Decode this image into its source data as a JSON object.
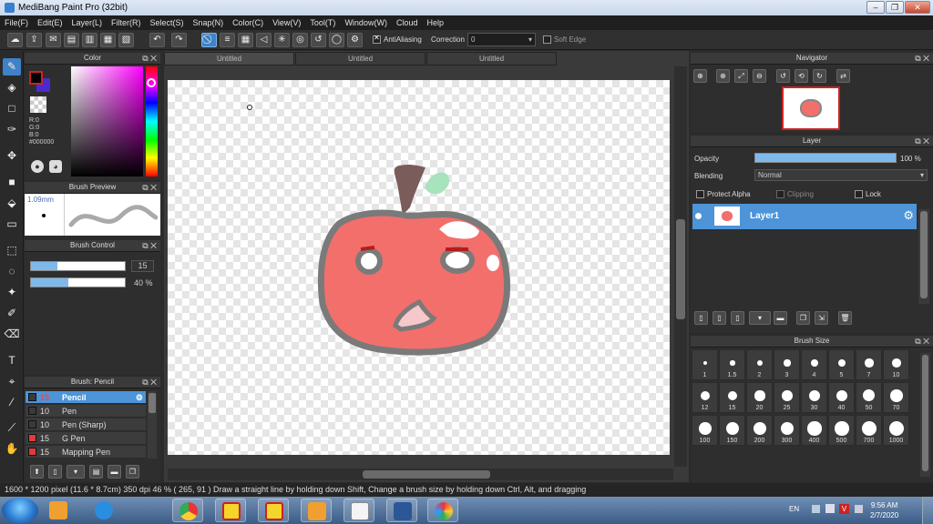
{
  "window": {
    "title": "MediBang Paint Pro (32bit)"
  },
  "menu": [
    "File(F)",
    "Edit(E)",
    "Layer(L)",
    "Filter(R)",
    "Select(S)",
    "Snap(N)",
    "Color(C)",
    "View(V)",
    "Tool(T)",
    "Window(W)",
    "Cloud",
    "Help"
  ],
  "toolbar": {
    "antialiasing_label": "AntiAliasing",
    "correction_label": "Correction",
    "correction_value": "0",
    "soft_edge_label": "Soft Edge"
  },
  "color_panel": {
    "title": "Color",
    "r": "R:0",
    "g": "G:0",
    "b": "B:0",
    "hex": "#000000",
    "foreground": "#000000",
    "background": "#4b2bd0"
  },
  "brush_preview": {
    "title": "Brush Preview",
    "size": "1.09mm"
  },
  "brush_control": {
    "title": "Brush Control",
    "size_value": "15",
    "size_fraction": 0.28,
    "opacity_value": "40 %",
    "opacity_fraction": 0.4
  },
  "brush_list": {
    "title": "Brush: Pencil",
    "items": [
      {
        "size": "15",
        "name": "Pencil",
        "color": "#4d94d8"
      },
      {
        "size": "10",
        "name": "Pen",
        "color": "#3c3c3c"
      },
      {
        "size": "10",
        "name": "Pen (Sharp)",
        "color": "#3c3c3c"
      },
      {
        "size": "15",
        "name": "G Pen",
        "color": "#e23a3a"
      },
      {
        "size": "15",
        "name": "Mapping Pen",
        "color": "#e23a3a"
      }
    ]
  },
  "documents": {
    "tabs": [
      "Untitled",
      "Untitled",
      "Untitled"
    ]
  },
  "navigator": {
    "title": "Navigator"
  },
  "layer_panel": {
    "title": "Layer",
    "opacity_label": "Opacity",
    "opacity_value": "100 %",
    "opacity_fraction": 1.0,
    "blending_label": "Blending",
    "blending_value": "Normal",
    "protect_alpha": "Protect Alpha",
    "clipping": "Clipping",
    "lock": "Lock",
    "layer_name": "Layer1"
  },
  "brush_size": {
    "title": "Brush Size",
    "sizes": [
      "1",
      "1.5",
      "2",
      "3",
      "4",
      "5",
      "7",
      "10",
      "12",
      "15",
      "20",
      "25",
      "30",
      "40",
      "50",
      "70",
      "100",
      "150",
      "200",
      "300",
      "400",
      "500",
      "700",
      "1000"
    ]
  },
  "status": {
    "text": "1600 * 1200 pixel   (11.6 * 8.7cm)   350 dpi   46 %   ( 265, 91 )   Draw a straight line by holding down Shift, Change a brush size by holding down Ctrl, Alt, and dragging"
  },
  "taskbar": {
    "lang": "EN",
    "time": "9:56 AM",
    "date": "2/7/2020"
  },
  "colors": {
    "accent": "#4d94d8",
    "apple": "#f26f6c",
    "outline": "#7a7a7a",
    "stem": "#7a5c5a",
    "leaf": "#a7e3bd"
  }
}
